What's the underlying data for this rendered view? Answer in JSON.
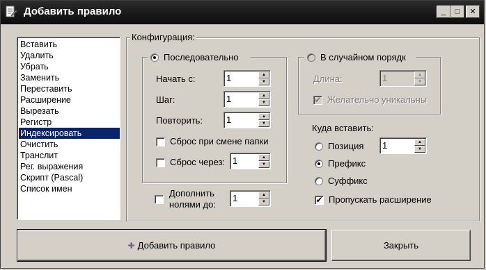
{
  "window": {
    "title": "Добавить правило",
    "controls": {
      "minimize": "_",
      "maximize": "□",
      "close": "✕"
    }
  },
  "rules_list": {
    "items": [
      "Вставить",
      "Удалить",
      "Убрать",
      "Заменить",
      "Переставить",
      "Расширение",
      "Вырезать",
      "Регистр",
      "Индексировать",
      "Очистить",
      "Транслит",
      "Рег. выражения",
      "Скрипт (Pascal)",
      "Список имен"
    ],
    "selected_index": 8
  },
  "config": {
    "legend": "Конфигурация:",
    "sequential": {
      "label": "Последовательно",
      "selected": true,
      "start_label": "Начать с:",
      "start_value": "1",
      "step_label": "Шаг:",
      "step_value": "1",
      "repeat_label": "Повторить:",
      "repeat_value": "1",
      "reset_folder_label": "Сброс при смене папки",
      "reset_folder_checked": false,
      "reset_every_label": "Сброс через:",
      "reset_every_checked": false,
      "reset_every_value": "1"
    },
    "random": {
      "label": "В случайном порядк",
      "selected": false,
      "length_label": "Длина:",
      "length_value": "1",
      "unique_label": "Желательно уникальны",
      "unique_checked": true
    },
    "pad": {
      "label_line1": "Дополнить",
      "label_line2": "нолями до:",
      "checked": false,
      "value": "1"
    },
    "insert_where": {
      "label": "Куда вставить:",
      "position_label": "Позиция",
      "position_value": "1",
      "prefix_label": "Префикс",
      "suffix_label": "Суффикс",
      "selected": "prefix",
      "skip_extension_label": "Пропускать расширение",
      "skip_extension_checked": true
    }
  },
  "buttons": {
    "add_label": "Добавить правило",
    "add_icon": "plus-icon",
    "close_label": "Закрыть"
  },
  "glyphs": {
    "check": "✔",
    "arrow_up": "▲",
    "arrow_down": "▼",
    "plus": "✚"
  },
  "colors": {
    "selection": "#0a246a",
    "plus_icon": "#7a5a8c"
  }
}
